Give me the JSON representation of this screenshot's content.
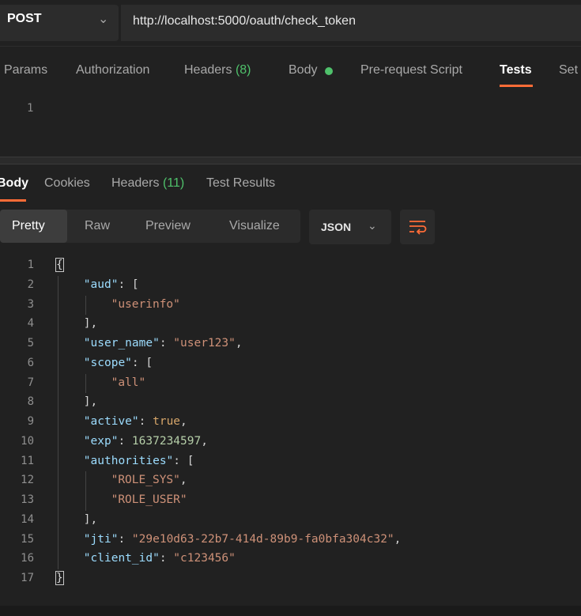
{
  "request": {
    "method": "POST",
    "url": "http://localhost:5000/oauth/check_token"
  },
  "request_tabs": [
    {
      "label": "Params"
    },
    {
      "label": "Authorization"
    },
    {
      "label": "Headers",
      "count": "(8)"
    },
    {
      "label": "Body"
    },
    {
      "label": "Pre-request Script"
    },
    {
      "label": "Tests",
      "active": true
    },
    {
      "label": "Set"
    }
  ],
  "script_editor": {
    "line": "1"
  },
  "response_tabs": [
    {
      "label": "Body",
      "active": true
    },
    {
      "label": "Cookies"
    },
    {
      "label": "Headers",
      "count": "(11)"
    },
    {
      "label": "Test Results"
    }
  ],
  "format_tabs": [
    {
      "label": "Pretty",
      "active": true
    },
    {
      "label": "Raw"
    },
    {
      "label": "Preview"
    },
    {
      "label": "Visualize"
    }
  ],
  "language": "JSON",
  "icons": {
    "method_dropdown": "chevron-down-icon",
    "language_dropdown": "chevron-down-icon",
    "wrap": "wrap-lines-icon",
    "body_status": "green-dot-icon"
  },
  "colors": {
    "accent": "#ff6c37",
    "green": "#4fc16b",
    "key": "#9cdcfe",
    "string": "#ce9178",
    "number": "#b5cea8"
  },
  "response_lines": [
    {
      "n": "1",
      "text": "{"
    },
    {
      "n": "2",
      "key": "\"aud\"",
      "rest": ": ["
    },
    {
      "n": "3",
      "str": "\"userinfo\""
    },
    {
      "n": "4",
      "text": "],"
    },
    {
      "n": "5",
      "key": "\"user_name\"",
      "rest": ": ",
      "str": "\"user123\"",
      "tail": ","
    },
    {
      "n": "6",
      "key": "\"scope\"",
      "rest": ": ["
    },
    {
      "n": "7",
      "str": "\"all\""
    },
    {
      "n": "8",
      "text": "],"
    },
    {
      "n": "9",
      "key": "\"active\"",
      "rest": ": ",
      "kw": "true",
      "tail": ","
    },
    {
      "n": "10",
      "key": "\"exp\"",
      "rest": ": ",
      "num": "1637234597",
      "tail": ","
    },
    {
      "n": "11",
      "key": "\"authorities\"",
      "rest": ": ["
    },
    {
      "n": "12",
      "str": "\"ROLE_SYS\"",
      "tail": ","
    },
    {
      "n": "13",
      "str": "\"ROLE_USER\""
    },
    {
      "n": "14",
      "text": "],"
    },
    {
      "n": "15",
      "key": "\"jti\"",
      "rest": ": ",
      "str": "\"29e10d63-22b7-414d-89b9-fa0bfa304c32\"",
      "tail": ","
    },
    {
      "n": "16",
      "key": "\"client_id\"",
      "rest": ": ",
      "str": "\"c123456\""
    },
    {
      "n": "17",
      "text": "}"
    }
  ]
}
